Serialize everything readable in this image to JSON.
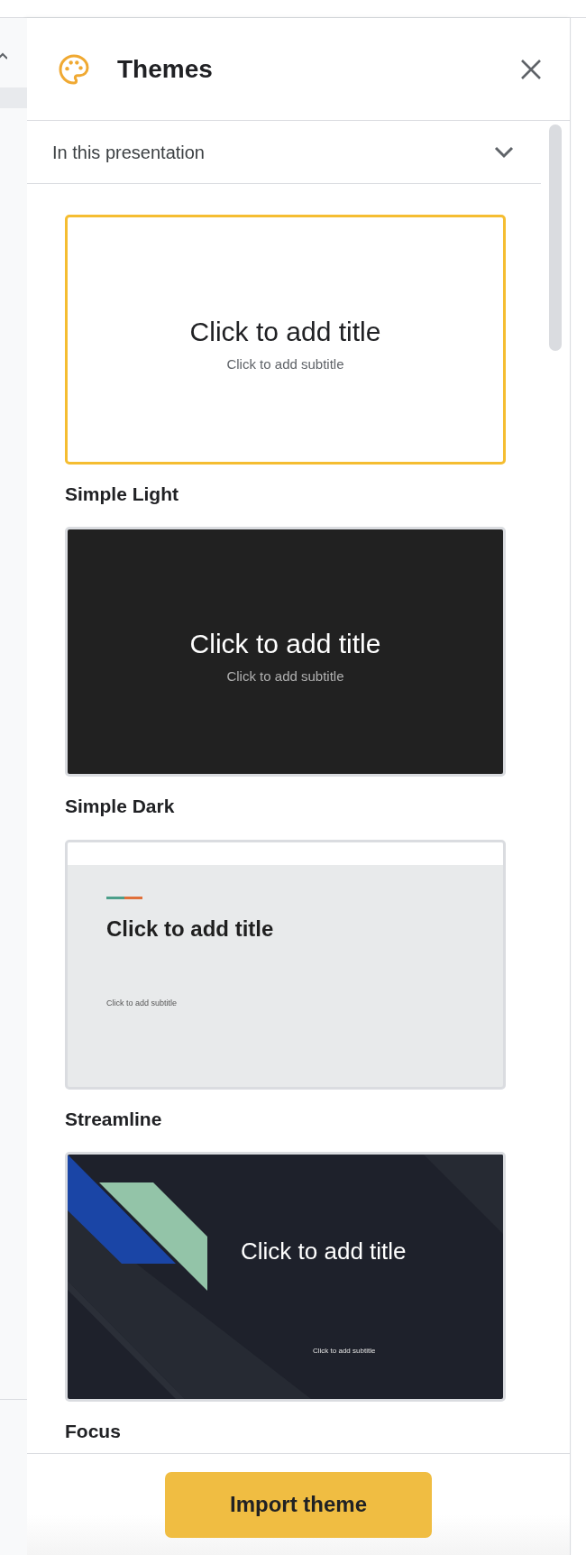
{
  "panel": {
    "title": "Themes",
    "filter": {
      "value": "In this presentation"
    }
  },
  "themes": [
    {
      "name": "Simple Light",
      "kind": "light",
      "selected": true,
      "slide_title": "Click to add title",
      "slide_subtitle": "Click to add subtitle"
    },
    {
      "name": "Simple Dark",
      "kind": "dark",
      "selected": false,
      "slide_title": "Click to add title",
      "slide_subtitle": "Click to add subtitle"
    },
    {
      "name": "Streamline",
      "kind": "streamline",
      "selected": false,
      "slide_title": "Click to add title",
      "slide_subtitle": "Click to add subtitle"
    },
    {
      "name": "Focus",
      "kind": "focus",
      "selected": false,
      "slide_title": "Click to add title",
      "slide_subtitle": "Click to add subtitle"
    }
  ],
  "footer": {
    "button": "Import theme"
  }
}
